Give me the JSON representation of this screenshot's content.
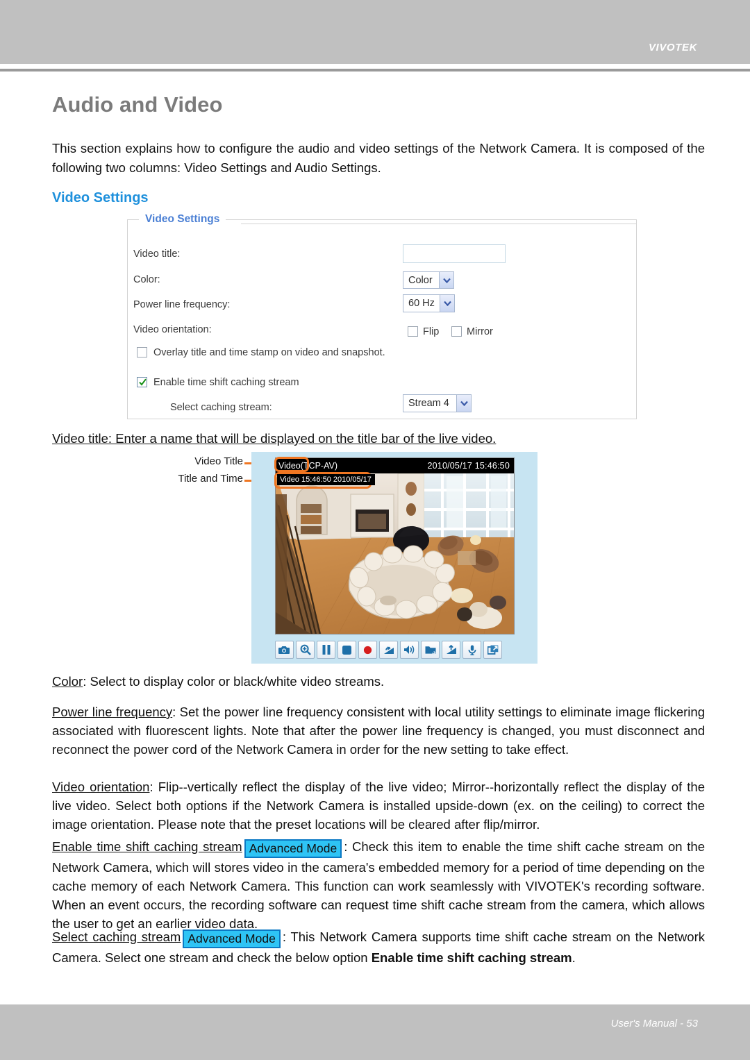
{
  "header": {
    "logo": "VIVOTEK"
  },
  "page": {
    "title": "Audio and Video",
    "intro": "This section explains how to configure the audio and video settings of the Network Camera. It is composed of the following two columns: Video Settings and Audio Settings.",
    "section_heading": "Video Settings"
  },
  "panel": {
    "legend": "Video Settings",
    "fields": {
      "video_title_label": "Video title:",
      "video_title_value": "",
      "video_title_placeholder": "",
      "color_label": "Color:",
      "color_value": "Color",
      "power_line_label": "Power line frequency:",
      "power_line_value": "60 Hz",
      "orientation_label": "Video orientation:",
      "flip_label": "Flip",
      "flip_checked": false,
      "mirror_label": "Mirror",
      "mirror_checked": false,
      "overlay_label": "Overlay title and time stamp on video and snapshot.",
      "overlay_checked": false,
      "timeshift_label": "Enable time shift caching stream",
      "timeshift_checked": true,
      "caching_stream_label": "Select caching stream:",
      "caching_stream_value": "Stream 4"
    }
  },
  "figure": {
    "caption": "Video title: Enter a name that will be displayed on the title bar of the live video.",
    "callout_video_title": "Video Title",
    "callout_title_and_time": "Title and Time",
    "titlebar_left": "Video(TCP-AV)",
    "titlebar_left_highlight": "Video",
    "titlebar_right": "2010/05/17  15:46:50",
    "overlay_stamp": "Video 15:46:50  2010/05/17",
    "toolbar_icons": [
      "snapshot-camera-icon",
      "digital-zoom-icon",
      "pause-icon",
      "stop-icon",
      "record-icon",
      "volume-down-icon",
      "speaker-icon",
      "folder-icon",
      "volume-up-icon",
      "microphone-icon",
      "fullscreen-icon"
    ]
  },
  "body": {
    "color_term": "Color",
    "color_text": ": Select to display color or black/white video streams.",
    "plf_term": "Power line frequency",
    "plf_text": ": Set the power line frequency consistent with local utility settings to eliminate image flickering associated with fluorescent lights. Note that after the power line frequency is changed, you must disconnect and reconnect the power cord of the Network Camera in order for the new setting to take effect.",
    "orient_term": "Video orientation",
    "orient_text": ": Flip--vertically reflect the display of the live video; Mirror--horizontally reflect the display of the live video. Select both options if the Network Camera is installed upside-down (ex. on the ceiling) to correct the image orientation.  Please note that the preset locations will be cleared after flip/mirror.",
    "ts_term": "Enable time shift caching stream",
    "ts_badge": "Advanced Mode",
    "ts_text": ": Check this item to enable the time shift cache stream on the Network Camera, which will stores video in the camera's embedded memory for a period of time depending on the cache memory of each Network Camera. This function can work seamlessly with VIVOTEK's recording software. When an event occurs, the recording software can request time shift cache stream from the camera, which allows the user to get an earlier video data.",
    "scs_term": "Select caching stream",
    "scs_badge": "Advanced Mode",
    "scs_text_a": ": This Network Camera supports time shift cache stream on the Network Camera. Select one stream and check the below option ",
    "scs_text_bold": "Enable time shift caching stream",
    "scs_text_b": "."
  },
  "footer": {
    "text": "User's Manual - 53"
  },
  "colors": {
    "band_gray": "#c0c0c0",
    "rule_gray": "#9a9a9a",
    "title_gray": "#7b7b7b",
    "heading_blue": "#1e90dc",
    "legend_blue": "#4a7fd4",
    "badge_cyan": "#2ec4f5",
    "badge_border": "#0b79c4",
    "callout_orange": "#ef7622",
    "video_frame_blue": "#c7e4f2"
  }
}
